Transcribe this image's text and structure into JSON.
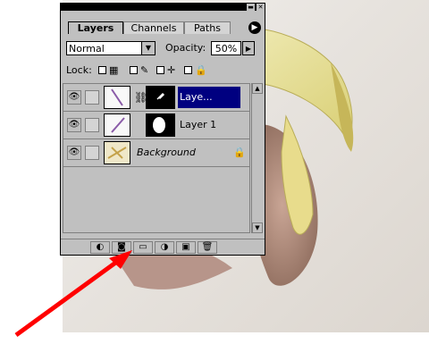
{
  "palette": {
    "title_buttons": [
      "minimize",
      "close"
    ],
    "tabs": [
      {
        "label": "Layers",
        "active": true
      },
      {
        "label": "Channels",
        "active": false
      },
      {
        "label": "Paths",
        "active": false
      }
    ],
    "menu_arrow": "palette-menu-icon"
  },
  "options": {
    "blend_mode": "Normal",
    "opacity_label": "Opacity:",
    "opacity_value": "50%"
  },
  "lock": {
    "label": "Lock:"
  },
  "layers": [
    {
      "name": "Laye...",
      "selected": true,
      "has_mask": true,
      "brush_indicator": "mask-icon"
    },
    {
      "name": "Layer 1",
      "selected": false,
      "has_mask": true
    },
    {
      "name": "Background",
      "selected": false,
      "locked": true
    }
  ],
  "bottom_buttons": [
    "layer-style-icon",
    "add-mask-icon",
    "new-set-icon",
    "adjustment-layer-icon",
    "new-layer-icon",
    "trash-icon"
  ],
  "colors": {
    "selection": "#000080",
    "palette_bg": "#c0c0c0",
    "arrow": "#ff0000"
  }
}
